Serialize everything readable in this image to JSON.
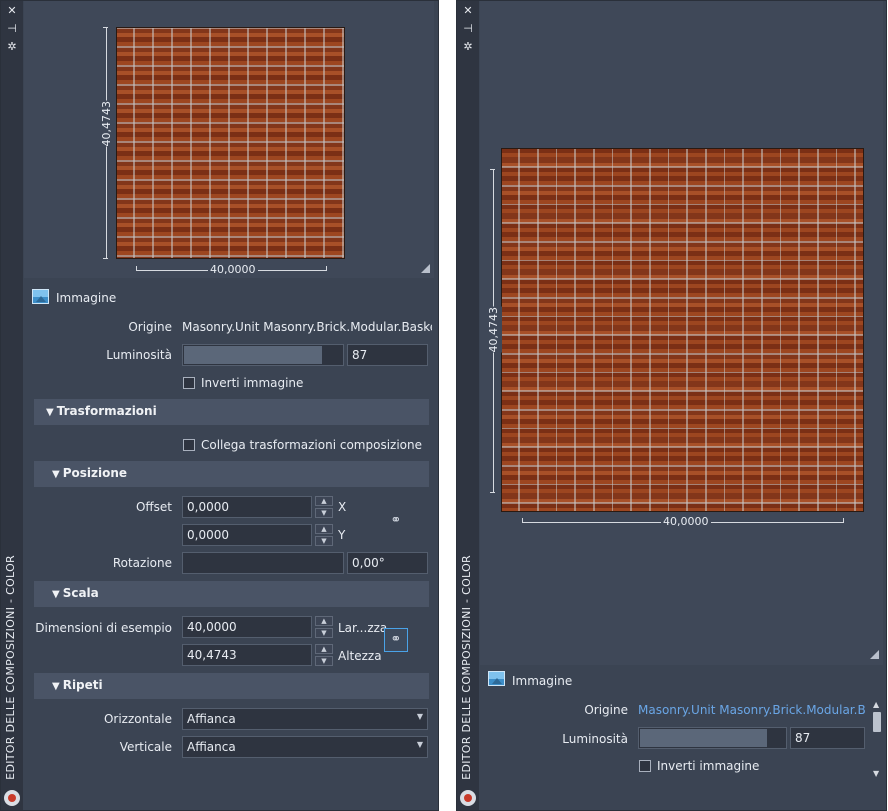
{
  "window": {
    "title": "EDITOR DELLE COMPOSIZIONI - COLOR"
  },
  "titlebar_icons": [
    "close-icon",
    "pin-icon",
    "gear-icon"
  ],
  "colors": {
    "panel_bg": "#3b4453",
    "section_bg": "#4a5466",
    "link": "#4aa3e8",
    "accent_blue": "#6aa6e6"
  },
  "left": {
    "preview": {
      "width_label": "40,0000",
      "height_label": "40,4743"
    },
    "image_section": {
      "title": "Immagine"
    },
    "origine": {
      "label": "Origine",
      "value": "Masonry.Unit Masonry.Brick.Modular.Basket W"
    },
    "luminosita": {
      "label": "Luminosità",
      "value": "87",
      "fill_fraction": 0.87
    },
    "inverti": {
      "label": "Inverti immagine",
      "checked": false
    },
    "trasformazioni": {
      "title": "Trasformazioni",
      "collega": {
        "label": "Collega trasformazioni composizione",
        "checked": false
      }
    },
    "posizione": {
      "title": "Posizione",
      "offset_label": "Offset",
      "offset_x": "0,0000",
      "offset_y": "0,0000",
      "x_label": "X",
      "y_label": "Y",
      "rotazione_label": "Rotazione",
      "rotazione_value": "0,00°"
    },
    "scala": {
      "title": "Scala",
      "dim_label": "Dimensioni di esempio",
      "width": "40,0000",
      "height": "40,4743",
      "width_axis": "Lar...zza",
      "height_axis": "Altezza"
    },
    "ripeti": {
      "title": "Ripeti",
      "orizzontale_label": "Orizzontale",
      "orizzontale_value": "Affianca",
      "verticale_label": "Verticale",
      "verticale_value": "Affianca"
    }
  },
  "right": {
    "preview": {
      "width_label": "40,0000",
      "height_label": "40,4743"
    },
    "image_section": {
      "title": "Immagine"
    },
    "origine": {
      "label": "Origine",
      "value": "Masonry.Unit Masonry.Brick.Modular.Baske"
    },
    "luminosita": {
      "label": "Luminosità",
      "value": "87",
      "fill_fraction": 0.87
    },
    "inverti": {
      "label": "Inverti immagine",
      "checked": false
    }
  }
}
